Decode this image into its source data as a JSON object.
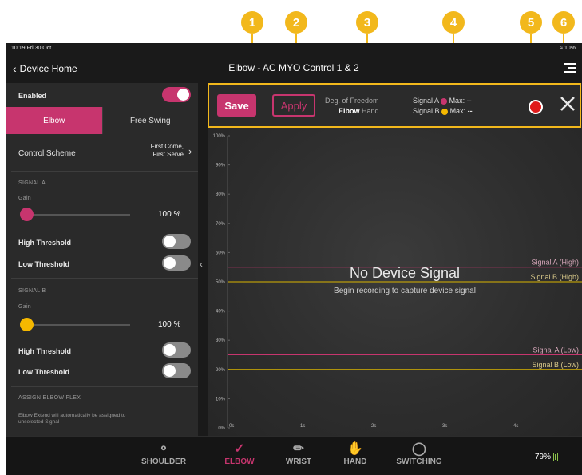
{
  "callouts": [
    "1",
    "2",
    "3",
    "4",
    "5",
    "6"
  ],
  "status": {
    "time": "10:19  Fri 30 Oct",
    "battery": "10%"
  },
  "nav": {
    "back_label": "Device Home",
    "title": "Elbow - AC MYO Control 1 & 2"
  },
  "sidebar": {
    "enabled_label": "Enabled",
    "enabled_on": true,
    "segments": [
      "Elbow",
      "Free Swing"
    ],
    "control_scheme_label": "Control Scheme",
    "control_scheme_value_line1": "First Come,",
    "control_scheme_value_line2": "First Serve",
    "signal_a": {
      "header": "SIGNAL A",
      "gain_label": "Gain",
      "gain_value": "100 %",
      "high_label": "High Threshold",
      "low_label": "Low Threshold"
    },
    "signal_b": {
      "header": "SIGNAL B",
      "gain_label": "Gain",
      "gain_value": "100 %",
      "high_label": "High Threshold",
      "low_label": "Low Threshold"
    },
    "assign_header": "ASSIGN ELBOW FLEX",
    "assign_note_line1": "Elbow Extend will automatically be assigned to",
    "assign_note_line2": "unselected Signal"
  },
  "toolbar": {
    "save_label": "Save",
    "apply_label": "Apply",
    "dof_label": "Deg. of Freedom",
    "dof_value_bold": "Elbow",
    "dof_value_other": "Hand",
    "signal_a_label": "Signal A",
    "signal_b_label": "Signal B",
    "max_label": "Max:",
    "max_a_value": "--",
    "max_b_value": "--"
  },
  "chart": {
    "no_signal": "No Device Signal",
    "no_signal_sub": "Begin recording to capture device signal",
    "y_ticks": [
      "100%",
      "90%",
      "80%",
      "70%",
      "60%",
      "50%",
      "40%",
      "30%",
      "20%",
      "10%",
      "0%"
    ],
    "x_ticks": [
      "0s",
      "1s",
      "2s",
      "3s",
      "4s"
    ],
    "thresholds": [
      {
        "label": "Signal A (High)",
        "percent": 55,
        "color": "#c7356e"
      },
      {
        "label": "Signal B (High)",
        "percent": 50,
        "color": "#d9b400"
      },
      {
        "label": "Signal A (Low)",
        "percent": 25,
        "color": "#c7356e"
      },
      {
        "label": "Signal B (Low)",
        "percent": 20,
        "color": "#d9b400"
      }
    ]
  },
  "tabs": [
    "SHOULDER",
    "ELBOW",
    "WRIST",
    "HAND",
    "SWITCHING"
  ],
  "battery_pct": "79%",
  "colors": {
    "accent": "#c7356e",
    "signal_a": "#c7356e",
    "signal_b": "#f5b800",
    "callout": "#f2b81c",
    "record": "#e01b1b"
  }
}
